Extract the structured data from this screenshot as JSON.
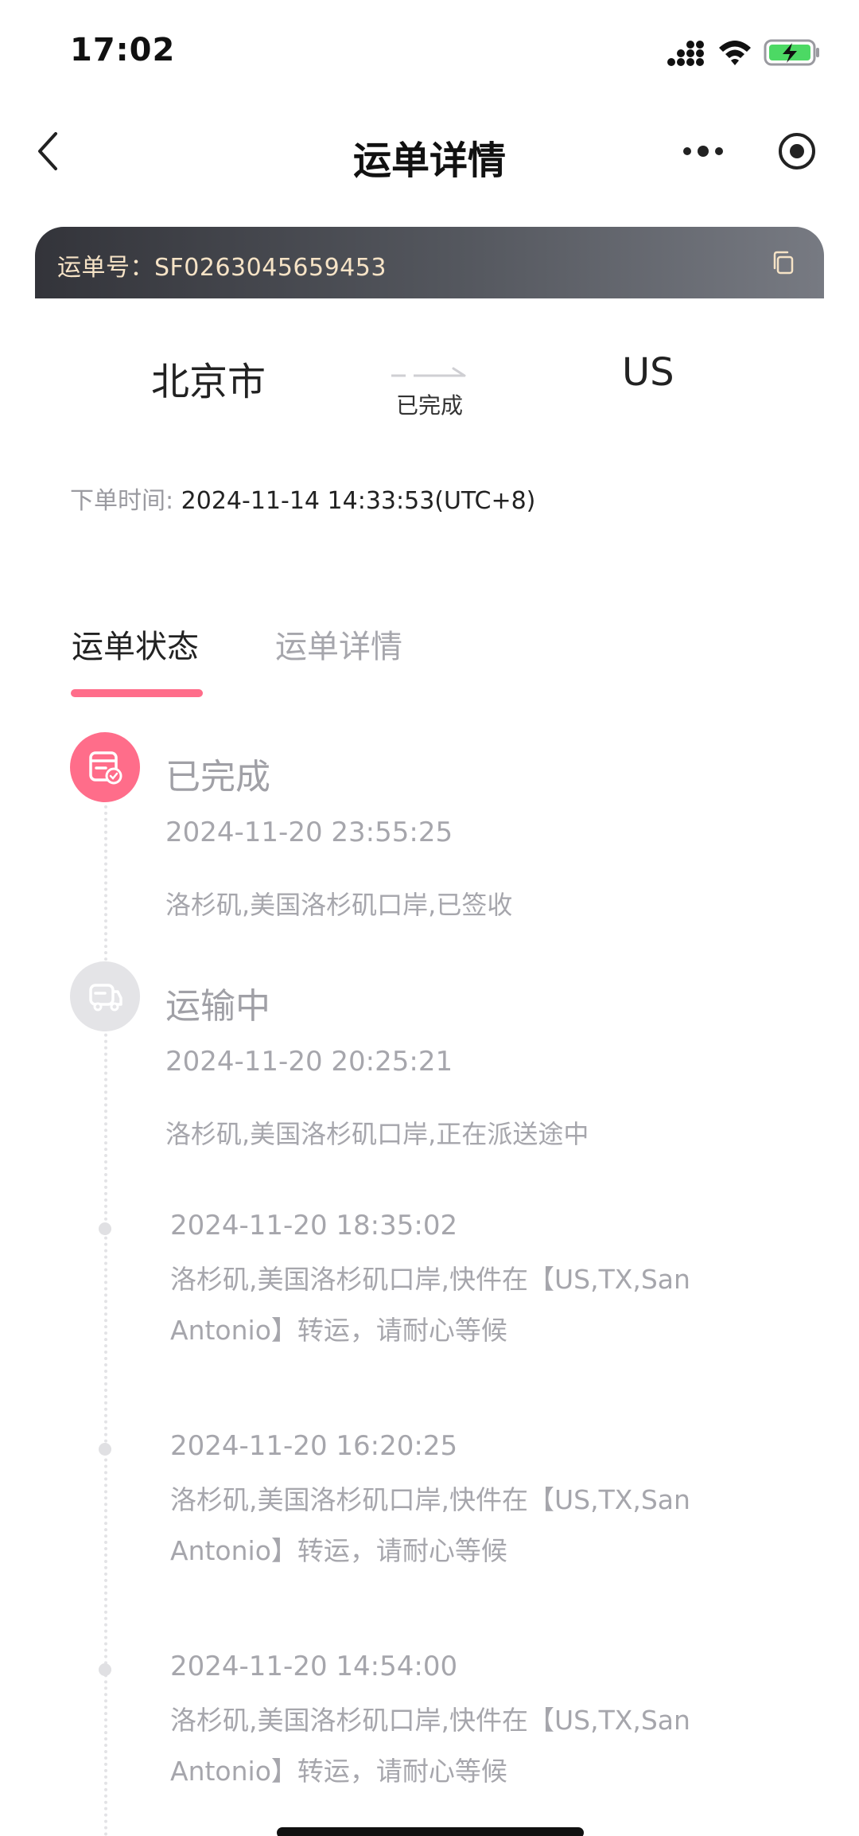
{
  "status_bar": {
    "time": "17:02",
    "icons": [
      "cellular-signal-icon",
      "wifi-icon",
      "battery-charging-icon"
    ]
  },
  "nav": {
    "title": "运单详情",
    "icons": [
      "back-chevron-icon",
      "more-dots-icon",
      "record-target-icon"
    ]
  },
  "waybill": {
    "label_and_number": "运单号：SF0263045659453",
    "copy_icon": "copy-icon"
  },
  "route": {
    "from": "北京市",
    "to": "US",
    "status": "已完成"
  },
  "order": {
    "time_label": "下单时间:",
    "time_value": "2024-11-14 14:33:53(UTC+8)"
  },
  "tabs": [
    {
      "label": "运单状态",
      "active": true
    },
    {
      "label": "运单详情",
      "active": false
    }
  ],
  "timeline": {
    "main": [
      {
        "title": "已完成",
        "time": "2024-11-20 23:55:25",
        "desc": "洛杉矶,美国洛杉矶口岸,已签收",
        "icon": "bill-check-icon"
      },
      {
        "title": "运输中",
        "time": "2024-11-20 20:25:21",
        "desc": "洛杉矶,美国洛杉矶口岸,正在派送途中",
        "icon": "truck-icon"
      }
    ],
    "sub": [
      {
        "time": "2024-11-20 18:35:02",
        "desc": "洛杉矶,美国洛杉矶口岸,快件在【US,TX,San Antonio】转运，请耐心等候"
      },
      {
        "time": "2024-11-20 16:20:25",
        "desc": "洛杉矶,美国洛杉矶口岸,快件在【US,TX,San Antonio】转运，请耐心等候"
      },
      {
        "time": "2024-11-20 14:54:00",
        "desc": "洛杉矶,美国洛杉矶口岸,快件在【US,TX,San Antonio】转运，请耐心等候"
      }
    ]
  },
  "colors": {
    "accent": "#ff6d8a",
    "banner_text": "#f6e3c6",
    "muted_text": "#a6a6ac"
  }
}
